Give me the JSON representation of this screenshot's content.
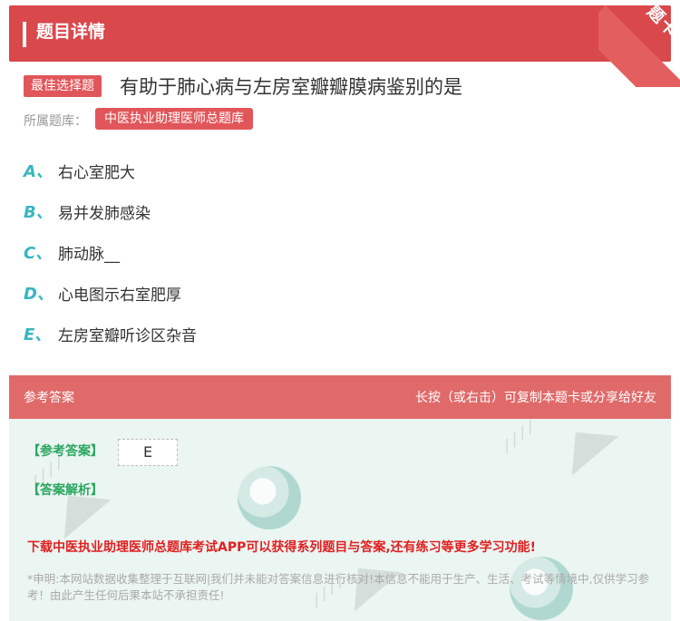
{
  "header": {
    "title": "题目详情",
    "corner": "题卡"
  },
  "question": {
    "type_tag": "最佳选择题",
    "text": "有助于肺心病与左房室瓣瓣膜病鉴别的是",
    "library_label": "所属题库：",
    "library_name": "中医执业助理医师总题库"
  },
  "options": [
    {
      "letter": "A、",
      "text": "右心室肥大"
    },
    {
      "letter": "B、",
      "text": "易并发肺感染"
    },
    {
      "letter": "C、",
      "text": "肺动脉__"
    },
    {
      "letter": "D、",
      "text": "心电图示右室肥厚"
    },
    {
      "letter": "E、",
      "text": "左房室瓣听诊区杂音"
    }
  ],
  "answer": {
    "header_left": "参考答案",
    "header_right": "长按（或右击）可复制本题卡或分享给好友",
    "ref_label": "【参考答案】",
    "ref_value": "E",
    "explain_label": "【答案解析】",
    "promo": "下载中医执业助理医师总题库考试APP可以获得系列题目与答案,还有练习等更多学习功能!",
    "disclaimer": "*申明:本网站数据收集整理于互联网|我们并未能对答案信息进行核对!本信息不能用于生产、生活、考试等情境中,仅供学习参考！由此产生任何后果本站不承担责任!"
  },
  "colors": {
    "header": "#d9484b",
    "tag": "#e1565a",
    "letter": "#37b6c0",
    "answer_green": "#2aa65f",
    "promo_red": "#e02020"
  }
}
